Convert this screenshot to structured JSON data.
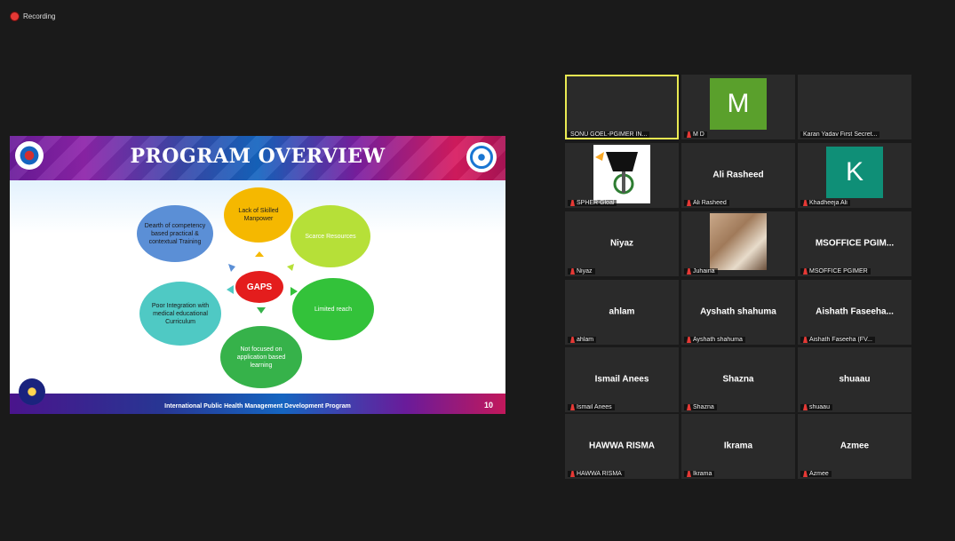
{
  "recording": {
    "label": "Recording"
  },
  "slide": {
    "title": "PROGRAM OVERVIEW",
    "center": "GAPS",
    "bubbles": [
      "Dearth of competency based practical & contextual Training",
      "Lack of Skilled Manpower",
      "Scarce Resources",
      "Limited reach",
      "Not focused on application based learning",
      "Poor Integration with medical educational Curriculum"
    ],
    "footer": "International Public Health Management Development Program",
    "page": "10"
  },
  "participants": [
    {
      "name": "",
      "label": "SONU GOEL-PGIMER IN...",
      "mic_off": false,
      "active": true
    },
    {
      "name": "",
      "label": "M D",
      "avatar": "M",
      "avatar_color": "#5aa02c",
      "mic_off": true
    },
    {
      "name": "",
      "label": "Karan Yadav First Secret...",
      "mic_off": false
    },
    {
      "name": "",
      "label": "SPHER Gloal",
      "photo": "logo",
      "mic_off": true
    },
    {
      "name": "Ali Rasheed",
      "label": "Ali Rasheed",
      "mic_off": true
    },
    {
      "name": "",
      "label": "Khadheeja Ali",
      "avatar": "K",
      "avatar_color": "#0f8f77",
      "mic_off": true
    },
    {
      "name": "Niyaz",
      "label": "Niyaz",
      "mic_off": true
    },
    {
      "name": "",
      "label": "Juhaina",
      "photo": "person",
      "mic_off": true
    },
    {
      "name": "MSOFFICE PGIM...",
      "label": "MSOFFICE PGIMER",
      "mic_off": true
    },
    {
      "name": "ahlam",
      "label": "ahlam",
      "mic_off": true
    },
    {
      "name": "Ayshath shahuma",
      "label": "Ayshath shahuma",
      "mic_off": true
    },
    {
      "name": "Aishath Faseeha...",
      "label": "Aishath Faseeha (FV...",
      "mic_off": true
    },
    {
      "name": "Ismail Anees",
      "label": "Ismail Anees",
      "mic_off": true
    },
    {
      "name": "Shazna",
      "label": "Shazna",
      "mic_off": true
    },
    {
      "name": "shuaau",
      "label": "shuaau",
      "mic_off": true
    },
    {
      "name": "HAWWA RISMA",
      "label": "HAWWA RISMA",
      "mic_off": true
    },
    {
      "name": "Ikrama",
      "label": "Ikrama",
      "mic_off": true
    },
    {
      "name": "Azmee",
      "label": "Azmee",
      "mic_off": true
    }
  ]
}
